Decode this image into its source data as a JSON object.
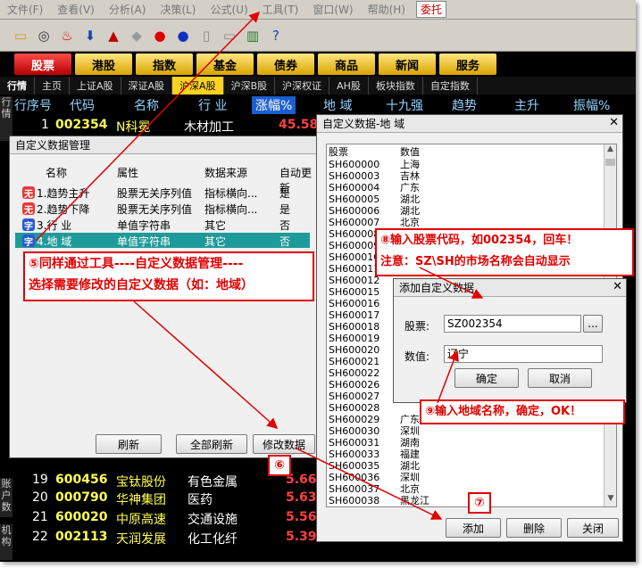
{
  "menu": [
    "文件(F)",
    "查看(V)",
    "分析(A)",
    "决策(L)",
    "公式(U)",
    "工具(T)",
    "窗口(W)",
    "帮助(H)",
    "委托"
  ],
  "toolbar_icons": [
    "open-icon",
    "binoculars-icon",
    "alarm-icon",
    "download-icon",
    "stock-chart-icon",
    "diamond-icon",
    "red-shield-icon",
    "blue-shield-icon",
    "doc-icon",
    "window-icon",
    "books-icon",
    "help-cursor-icon"
  ],
  "tabs": [
    "股票",
    "港股",
    "指数",
    "基金",
    "债券",
    "商品",
    "新闻",
    "服务"
  ],
  "market_tabs": [
    "行情",
    "主页",
    "上证A股",
    "深证A股",
    "沪深A股",
    "沪深B股",
    "沪深权证",
    "AH股",
    "板块指数",
    "自定指数"
  ],
  "columns": {
    "seq": "行序号",
    "code": "代码",
    "name": "名称",
    "industry": "行 业",
    "change": "涨幅%",
    "region": "地 域",
    "ma19": "十九强",
    "trend": "趋势",
    "rise": "主升",
    "amp": "振幅%"
  },
  "side_labels": {
    "top": "行情",
    "bottom1": "账户数",
    "bottom2": "机构"
  },
  "stocks": [
    {
      "num": "1",
      "code": "002354",
      "name": "N科冕",
      "industry": "木材加工",
      "change": "45.58"
    },
    {
      "num": "19",
      "code": "600456",
      "name": "宝钛股份",
      "industry": "有色金属",
      "change": "5.66"
    },
    {
      "num": "20",
      "code": "000790",
      "name": "华神集团",
      "industry": "医药",
      "change": "5.63"
    },
    {
      "num": "21",
      "code": "600020",
      "name": "中原高速",
      "industry": "交通设施",
      "change": "5.56"
    },
    {
      "num": "22",
      "code": "002113",
      "name": "天润发展",
      "industry": "化工化纤",
      "change": "5.39"
    }
  ],
  "manage_dialog": {
    "title": "自定义数据管理",
    "headers": [
      "名称",
      "属性",
      "数据来源",
      "自动更新"
    ],
    "rows": [
      {
        "icon": "无",
        "name": "1.趋势主升",
        "attr": "股票无关序列值",
        "source": "指标横向...",
        "auto": "是"
      },
      {
        "icon": "无",
        "name": "2.趋势下降",
        "attr": "股票无关序列值",
        "source": "指标横向...",
        "auto": "是"
      },
      {
        "icon": "字",
        "name": "3.行  业",
        "attr": "单值字符串",
        "source": "其它",
        "auto": "否"
      },
      {
        "icon": "字",
        "name": "4.地  域",
        "attr": "单值字符串",
        "source": "其它",
        "auto": "否"
      }
    ],
    "buttons": {
      "refresh": "刷新",
      "refresh_all": "全部刷新",
      "modify": "修改数据"
    }
  },
  "region_dialog": {
    "title": "自定义数据-地  域",
    "headers": [
      "股票",
      "数值"
    ],
    "rows": [
      [
        "SH600000",
        "上海"
      ],
      [
        "SH600003",
        "吉林"
      ],
      [
        "SH600004",
        "广东"
      ],
      [
        "SH600005",
        "湖北"
      ],
      [
        "SH600006",
        "湖北"
      ],
      [
        "SH600007",
        "北京"
      ],
      [
        "SH600008",
        ""
      ],
      [
        "SH600009",
        ""
      ],
      [
        "SH600010",
        ""
      ],
      [
        "SH600011",
        ""
      ],
      [
        "SH600012",
        ""
      ],
      [
        "SH600015",
        ""
      ],
      [
        "SH600016",
        ""
      ],
      [
        "SH600017",
        ""
      ],
      [
        "SH600018",
        ""
      ],
      [
        "SH600019",
        ""
      ],
      [
        "SH600020",
        ""
      ],
      [
        "SH600021",
        ""
      ],
      [
        "SH600022",
        ""
      ],
      [
        "SH600026",
        ""
      ],
      [
        "SH600027",
        ""
      ],
      [
        "SH600028",
        ""
      ],
      [
        "SH600029",
        "广东"
      ],
      [
        "SH600030",
        "深圳"
      ],
      [
        "SH600031",
        "湖南"
      ],
      [
        "SH600033",
        "福建"
      ],
      [
        "SH600035",
        "湖北"
      ],
      [
        "SH600036",
        "深圳"
      ],
      [
        "SH600037",
        "北京"
      ],
      [
        "SH600038",
        "黑龙江"
      ]
    ],
    "buttons": {
      "add": "添加",
      "delete": "删除",
      "close": "关闭"
    }
  },
  "add_dialog": {
    "title": "添加自定义数据",
    "stock_label": "股票:",
    "stock_value": "SZ002354",
    "browse": "...",
    "value_label": "数值:",
    "value_value": "辽宁",
    "ok": "确定",
    "cancel": "取消"
  },
  "annotations": {
    "step5_line1": "⑤同样通过工具----自定义数据管理----",
    "step5_line2": "选择需要修改的自定义数据（如：地域）",
    "step6": "⑥",
    "step7": "⑦",
    "step8_line1": "⑧输入股票代码，如002354，回车！",
    "step8_line2": "注意：SZ\\SH的市场名称会自动显示",
    "step9": "⑨输入地域名称，确定，OK！"
  },
  "colors": {
    "annotation": "#e00000",
    "selected_row": "#1f9a9a",
    "gold_tab": "#ffd21e",
    "red_tab": "#cc0000"
  }
}
